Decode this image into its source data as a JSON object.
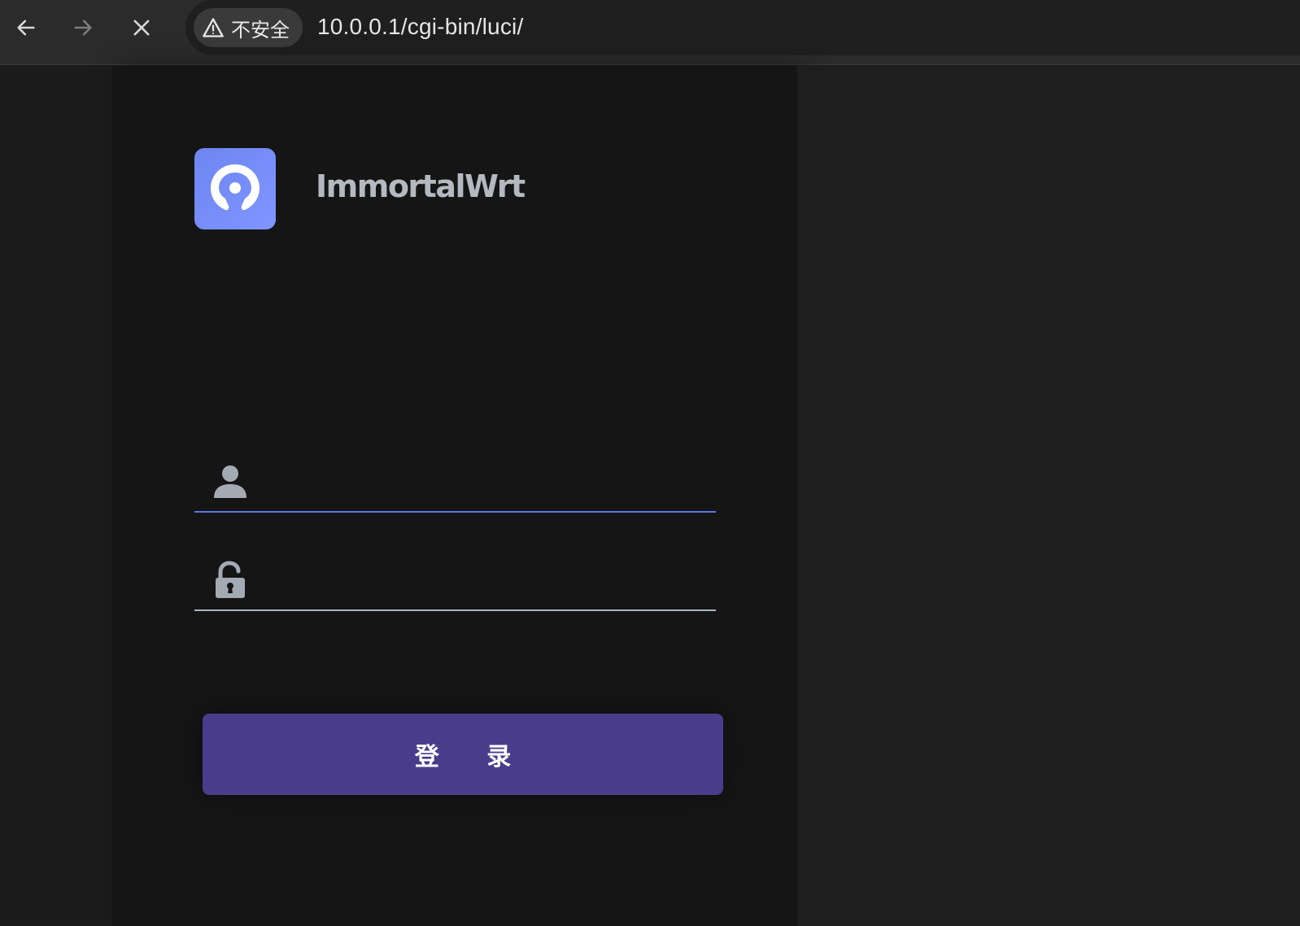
{
  "browser": {
    "security_label": "不安全",
    "url": "10.0.0.1/cgi-bin/luci/"
  },
  "brand": {
    "name": "ImmortalWrt",
    "logo_color": "#7488f5"
  },
  "login": {
    "username_value": "",
    "password_value": "",
    "submit_label": "登 录"
  },
  "colors": {
    "accent": "#5b76e6",
    "button": "#493d8b",
    "panel": "#151515"
  }
}
